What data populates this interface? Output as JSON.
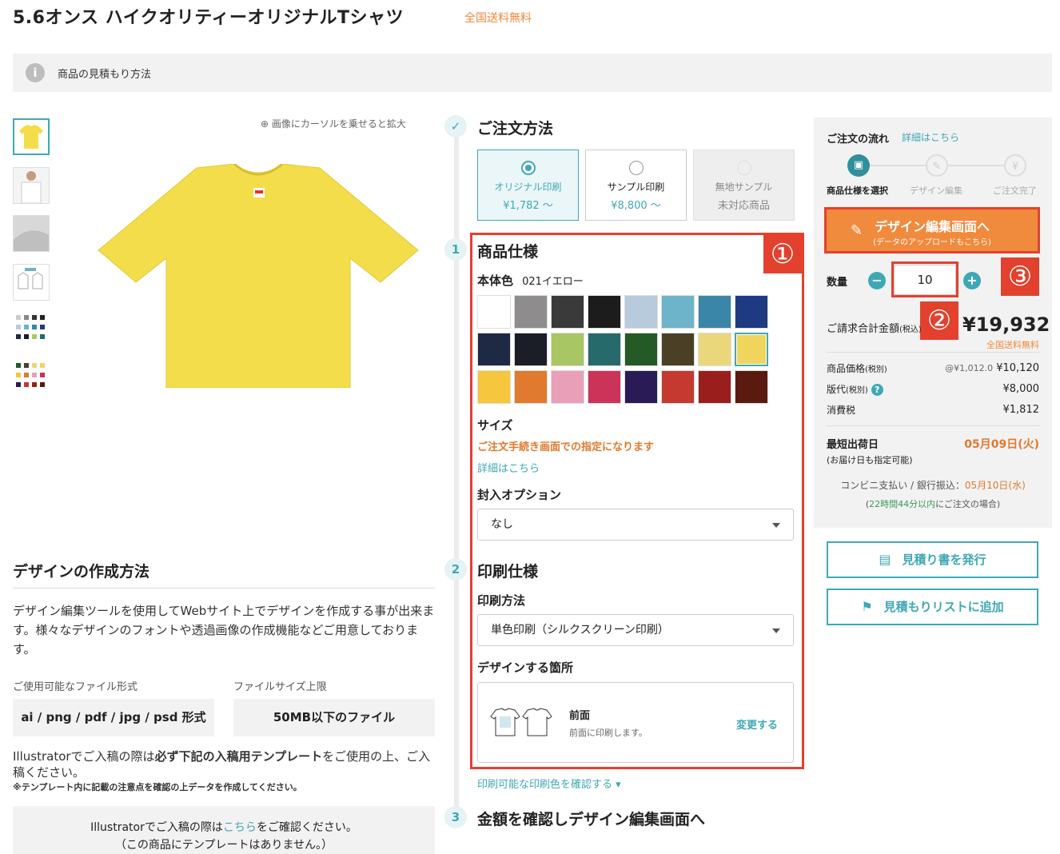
{
  "product": {
    "title": "5.6オンス ハイクオリティーオリジナルTシャツ",
    "free_shipping": "全国送料無料"
  },
  "info": {
    "icon": "info-icon",
    "text": "商品の見積もり方法"
  },
  "gallery": {
    "zoom_hint": "画像にカーソルを乗せると拡大",
    "main_color": "#f3dd4b"
  },
  "order_method": {
    "title": "ご注文方法",
    "options": [
      {
        "name": "オリジナル印刷",
        "price": "¥1,782 〜"
      },
      {
        "name": "サンプル印刷",
        "price": "¥8,800 〜"
      },
      {
        "name": "無地サンプル",
        "price": "未対応商品"
      }
    ]
  },
  "spec": {
    "step": "1",
    "title": "商品仕様",
    "color_label": "本体色",
    "color_value": "021イエロー",
    "colors": [
      "#ffffff",
      "#8e8c8c",
      "#3a3a3a",
      "#1c1c1c",
      "#b8cbdc",
      "#6db3c9",
      "#3a86a8",
      "#1e3b82",
      "#1e2a44",
      "#1b1e26",
      "#a8c764",
      "#266a6b",
      "#235a25",
      "#4a4026",
      "#ead77b",
      "#f0d55c",
      "#f5c63e",
      "#e07a2e",
      "#e89fb7",
      "#cc3358",
      "#2a1a55",
      "#c43a30",
      "#9a1f1c",
      "#5a1a10"
    ],
    "size_label": "サイズ",
    "size_note": "ご注文手続き画面での指定になります",
    "size_link": "詳細はこちら",
    "insert_label": "封入オプション",
    "insert_value": "なし",
    "badge1": "①"
  },
  "print": {
    "step": "2",
    "title": "印刷仕様",
    "method_label": "印刷方法",
    "method_value": "単色印刷（シルクスクリーン印刷）",
    "area_label": "デザインする箇所",
    "area_name": "前面",
    "area_desc": "前面に印刷します。",
    "area_change": "変更する",
    "colors_link": "印刷可能な印刷色を確認する ▾"
  },
  "step3": {
    "step": "3",
    "title": "金額を確認しデザイン編集画面へ"
  },
  "design_info": {
    "title": "デザインの作成方法",
    "body": "デザイン編集ツールを使用してWebサイト上でデザインを作成する事が出来ます。様々なデザインのフォントや透過画像の作成機能などご用意しております。",
    "formats_label": "ご使用可能なファイル形式",
    "formats_value": "ai / png / pdf / jpg / psd 形式",
    "size_label": "ファイルサイズ上限",
    "size_value": "50MB以下のファイル",
    "illustrator_note_a": "Illustratorでご入稿の際は",
    "illustrator_note_b": "必ず下記の入稿用テンプレート",
    "illustrator_note_c": "をご使用の上、ご入稿ください。",
    "template_note": "※テンプレート内に記載の注意点を確認の上データを作成してください。",
    "box_a": "Illustratorでご入稿の際は",
    "box_link": "こちら",
    "box_b": "をご確認ください。",
    "box_c": "（この商品にテンプレートはありません。）"
  },
  "sidebar": {
    "flow_title": "ご注文の流れ",
    "flow_link": "詳細はこちら",
    "flow_steps": [
      "商品仕様を選択",
      "デザイン編集",
      "ご注文完了"
    ],
    "design_button": "デザイン編集画面へ",
    "design_button_sub": "(データのアップロードもこちら)",
    "qty_label": "数量",
    "qty_value": "10",
    "total_label": "ご請求合計金額",
    "total_tax": "(税込)",
    "total_value": "¥19,932",
    "total_free": "全国送料無料",
    "rows": [
      {
        "label": "商品価格",
        "tax": "(税別)",
        "unit": "@¥1,012.0",
        "value": "¥10,120"
      },
      {
        "label": "版代",
        "tax": "(税別)",
        "unit": "",
        "value": "¥8,000"
      },
      {
        "label": "消費税",
        "tax": "",
        "unit": "",
        "value": "¥1,812"
      }
    ],
    "ship_label": "最短出荷日",
    "ship_note": "(お届け日も指定可能)",
    "ship_date": "05月09日(火)",
    "conv_label": "コンビニ支払い / 銀行振込：",
    "conv_date": "05月10日(水)",
    "deadline_a": "(",
    "deadline_b": "22時間44分以内",
    "deadline_c": "にご注文の場合)",
    "quote_button": "見積り書を発行",
    "list_button": "見積もりリストに追加",
    "badge2": "②",
    "badge3": "③"
  }
}
